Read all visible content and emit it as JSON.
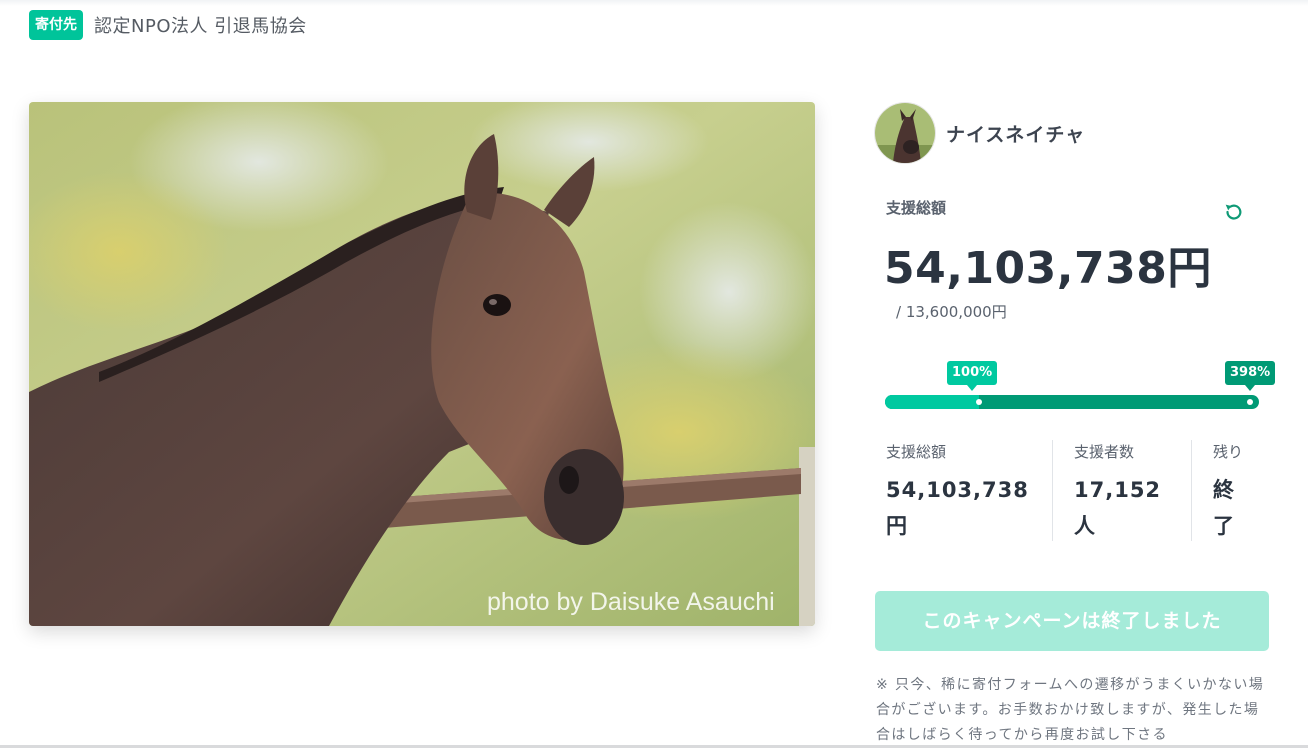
{
  "header": {
    "badge": "寄付先",
    "org_name": "認定NPO法人 引退馬協会"
  },
  "hero": {
    "photo_credit": "photo by Daisuke Asauchi"
  },
  "project": {
    "name": "ナイスネイチャ"
  },
  "summary": {
    "label": "支援総額",
    "amount": "54,103,738円",
    "goal": "/ 13,600,000円",
    "refresh_icon": "refresh-icon"
  },
  "progress": {
    "marker_first": "100%",
    "marker_final": "398%",
    "percent": 398
  },
  "stats": {
    "total_label": "支援総額",
    "total_value": "54,103,738円",
    "supporters_label": "支援者数",
    "supporters_value": "17,152人",
    "remaining_label": "残り",
    "remaining_value": "終了"
  },
  "cta": {
    "ended_label": "このキャンペーンは終了しました"
  },
  "note": "※ 只今、稀に寄付フォームへの遷移がうまくいかない場合がございます。お手数おかけ致しますが、発生した場合はしばらく待ってから再度お試し下さる",
  "colors": {
    "accent": "#00c9a0",
    "accent_dark": "#009a75",
    "badge": "#00c49a",
    "ended_button": "#a5ebd9"
  }
}
